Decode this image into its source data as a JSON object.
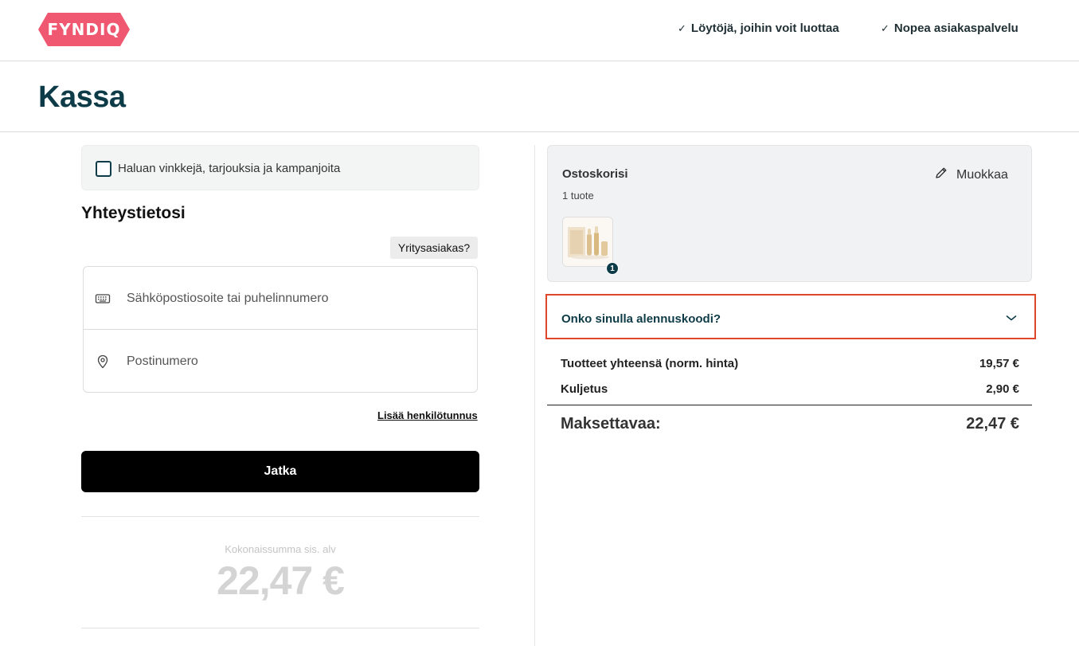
{
  "header": {
    "logo_text": "FYNDIQ",
    "brand_color": "#ef5870",
    "usps": [
      {
        "check": "✓",
        "label": "Löytöjä, joihin voit luottaa"
      },
      {
        "check": "✓",
        "label": "Nopea asiakaspalvelu"
      }
    ]
  },
  "page": {
    "title": "Kassa"
  },
  "newsletter": {
    "label": "Haluan vinkkejä, tarjouksia ja kampanjoita",
    "checked": false
  },
  "contact": {
    "heading": "Yhteystietosi",
    "company_button": "Yritysasiakas?",
    "fields": [
      {
        "icon": "keyboard-icon",
        "placeholder": "Sähköpostiosoite tai puhelinnumero"
      },
      {
        "icon": "location-pin-icon",
        "placeholder": "Postinumero"
      }
    ],
    "personal_id_link": "Lisää henkilötunnus",
    "continue_button": "Jatka"
  },
  "left_total": {
    "label": "Kokonaissumma sis. alv",
    "amount": "22,47 €"
  },
  "cart": {
    "title": "Ostoskorisi",
    "count": "1 tuote",
    "edit_label": "Muokkaa",
    "item_quantity": "1"
  },
  "discount": {
    "label": "Onko sinulla alennuskoodi?",
    "highlight_color": "#e0462a"
  },
  "summary": {
    "rows": [
      {
        "label": "Tuotteet yhteensä (norm. hinta)",
        "value": "19,57 €"
      },
      {
        "label": "Kuljetus",
        "value": "2,90 €"
      }
    ],
    "total_label": "Maksettavaa:",
    "total_value": "22,47 €"
  }
}
